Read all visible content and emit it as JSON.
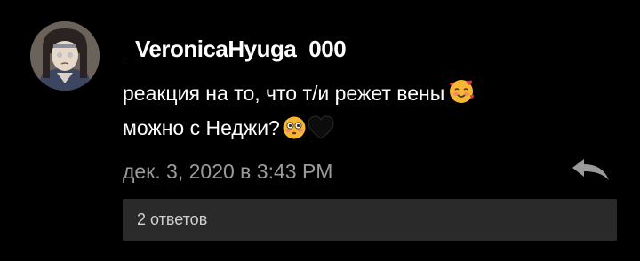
{
  "comment": {
    "username": "_VeronicaHyuga_000",
    "text_line_1": "реакция на то, что т/и режет вены",
    "text_line_2": "можно с Неджи?",
    "emoji_line_1": "smiling-face-with-hearts",
    "emoji_line_2": [
      "flushed-face",
      "black-heart"
    ],
    "timestamp": "дек. 3, 2020 в 3:43 PM",
    "replies_label": "2 ответов"
  },
  "colors": {
    "background": "#000000",
    "text": "#ffffff",
    "muted": "#9a9a9a",
    "replies_bar": "#2a2a2a"
  }
}
